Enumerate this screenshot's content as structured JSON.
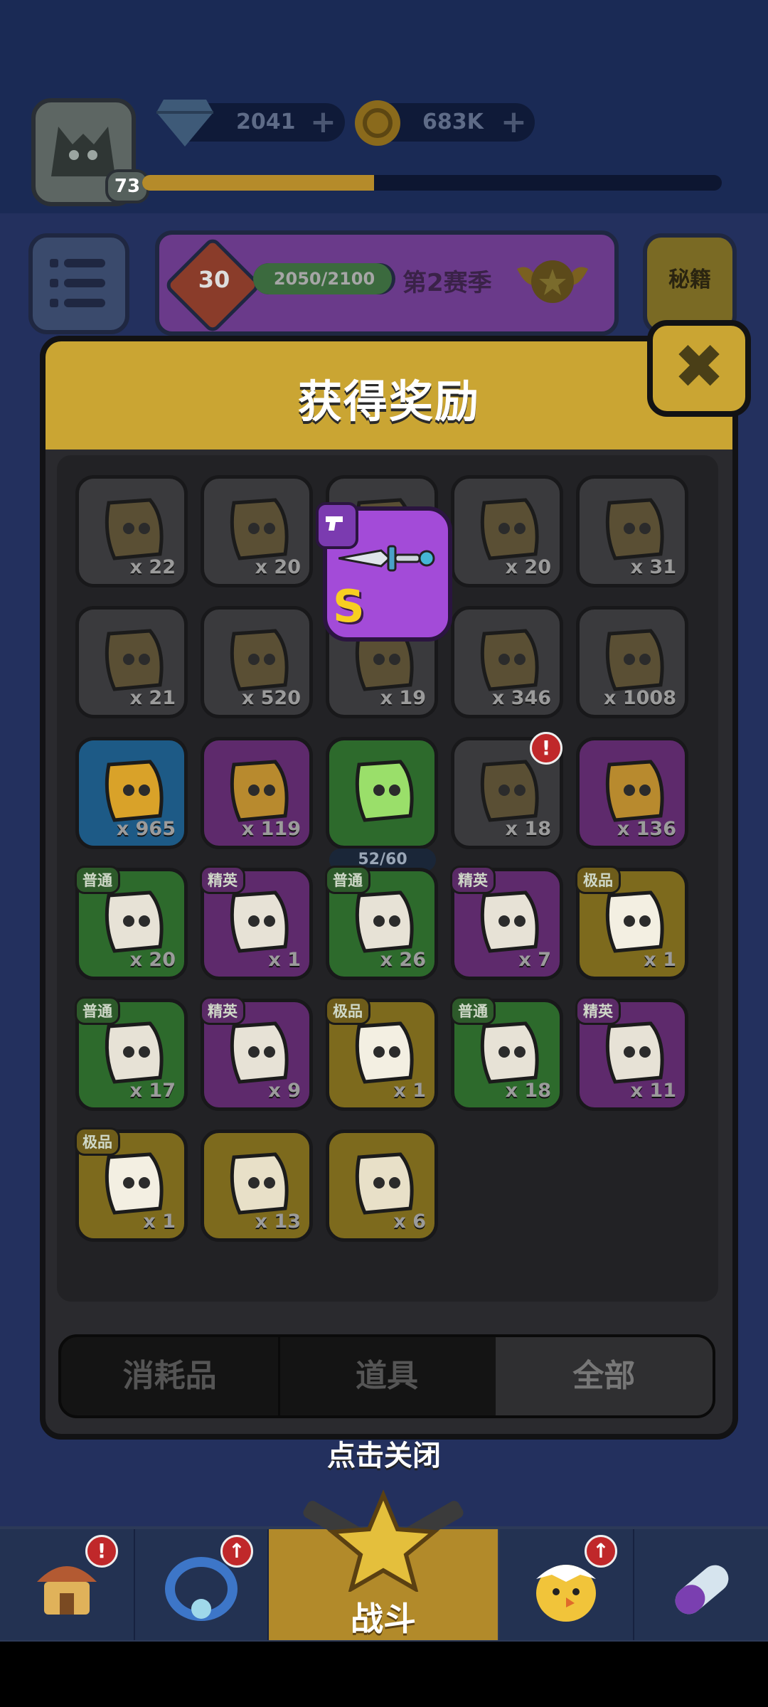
{
  "hud": {
    "level": "73",
    "gems": "2041",
    "coins": "683K",
    "xp_fraction": 0.4
  },
  "season": {
    "rank": "30",
    "progress_text": "2050/2100",
    "progress_fraction": 0.976,
    "label": "第2赛季"
  },
  "secret_button": "秘籍",
  "dialog": {
    "title": "获得奖励",
    "close_icon": "close-x-icon",
    "new_item_grade": "S",
    "rows": [
      [
        {
          "count": "x 22",
          "style": "grey",
          "icon": "gun-icon"
        },
        {
          "count": "x 20",
          "style": "grey",
          "icon": "ring-icon"
        },
        {
          "count": "",
          "style": "grey",
          "icon": "weapon-icon"
        },
        {
          "count": "x 20",
          "style": "grey",
          "icon": "cape-icon"
        },
        {
          "count": "x 31",
          "style": "grey",
          "icon": "belt-icon"
        }
      ],
      [
        {
          "count": "x 21",
          "style": "grey",
          "icon": "boot-icon"
        },
        {
          "count": "x 520",
          "style": "grey",
          "icon": "ninja-icon"
        },
        {
          "count": "x 19",
          "style": "grey",
          "icon": "pet-icon"
        },
        {
          "count": "x 346",
          "style": "grey",
          "icon": "bird-icon"
        },
        {
          "count": "x 1008",
          "style": "grey",
          "icon": "cow-icon"
        }
      ],
      [
        {
          "count": "x 965",
          "style": "blue",
          "icon": "potion-icon"
        },
        {
          "count": "x 119",
          "style": "purple",
          "icon": "star-coin-icon"
        },
        {
          "count": "",
          "style": "green",
          "icon": "shirt-token-icon",
          "progress": "52/60"
        },
        {
          "count": "x 18",
          "style": "grey",
          "icon": "robot-chest-icon",
          "alert": "!"
        },
        {
          "count": "x 136",
          "style": "purple",
          "icon": "cross-icon"
        }
      ],
      [
        {
          "count": "x 20",
          "style": "green",
          "badge": "普通",
          "badge_style": "green",
          "icon": "ninja-bot-piece-icon"
        },
        {
          "count": "x 1",
          "style": "purple",
          "badge": "精英",
          "badge_style": "purple",
          "icon": "robot-piece-icon"
        },
        {
          "count": "x 26",
          "style": "green",
          "badge": "普通",
          "badge_style": "green",
          "icon": "cheese-piece-icon"
        },
        {
          "count": "x 7",
          "style": "purple",
          "badge": "精英",
          "badge_style": "purple",
          "icon": "chick-piece-icon"
        },
        {
          "count": "x 1",
          "style": "yellow",
          "badge": "极品",
          "badge_style": "yellow",
          "icon": "clown-piece-icon"
        }
      ],
      [
        {
          "count": "x 17",
          "style": "green",
          "badge": "普通",
          "badge_style": "green",
          "icon": "red-blob-piece-icon"
        },
        {
          "count": "x 9",
          "style": "purple",
          "badge": "精英",
          "badge_style": "purple",
          "icon": "red-cat-piece-icon"
        },
        {
          "count": "x 1",
          "style": "yellow",
          "badge": "极品",
          "badge_style": "yellow",
          "icon": "red-monster-piece-icon"
        },
        {
          "count": "x 18",
          "style": "green",
          "badge": "普通",
          "badge_style": "green",
          "icon": "sheep-piece-icon"
        },
        {
          "count": "x 11",
          "style": "purple",
          "badge": "精英",
          "badge_style": "purple",
          "icon": "green-ghost-piece-icon"
        }
      ],
      [
        {
          "count": "x 1",
          "style": "yellow",
          "badge": "极品",
          "badge_style": "yellow",
          "icon": "angry-hero-piece-icon"
        },
        {
          "count": "x 13",
          "style": "yellow",
          "icon": "red-mask-piece-icon"
        },
        {
          "count": "x 6",
          "style": "yellow",
          "icon": "cool-hero-piece-icon"
        }
      ]
    ],
    "tabs": [
      "消耗品",
      "道具",
      "全部"
    ],
    "active_tab": 2
  },
  "hint": "点击关闭",
  "nav": {
    "items": [
      {
        "name": "shop",
        "icon": "house-icon",
        "alert": "!"
      },
      {
        "name": "gear",
        "icon": "ring-icon",
        "alert": "↑"
      },
      {
        "name": "fight",
        "label": "战斗",
        "icon": "star-guns-icon"
      },
      {
        "name": "heroes",
        "icon": "chick-hero-icon",
        "alert": "↑"
      },
      {
        "name": "pills",
        "icon": "pill-icon"
      }
    ]
  }
}
